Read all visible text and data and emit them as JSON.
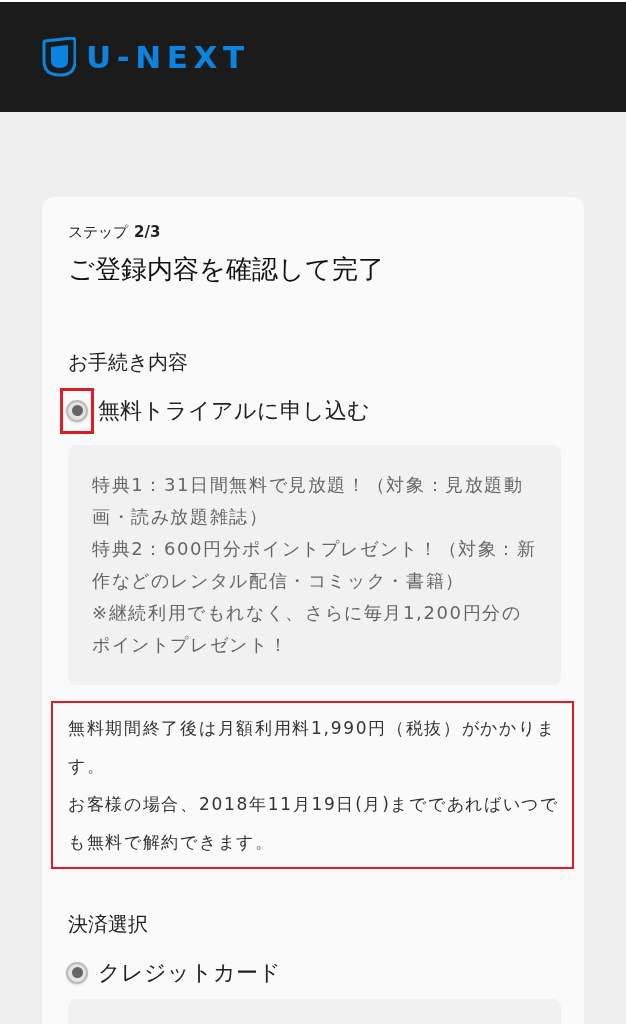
{
  "header": {
    "logo_text": "U-NEXT"
  },
  "card": {
    "step_label": "ステップ",
    "step_value": "2/3",
    "title": "ご登録内容を確認して完了",
    "sections": [
      {
        "heading": "お手続き内容",
        "options": [
          {
            "label": "無料トライアルに申し込む",
            "selected": true,
            "highlighted": true
          }
        ],
        "details": [
          "特典1：31日間無料で見放題！（対象：見放題動画・読み放題雑誌）",
          "特典2：600円分ポイントプレゼント！（対象：新作などのレンタル配信・コミック・書籍）",
          "※継続利用でもれなく、さらに毎月1,200円分のポイントプレゼント！"
        ],
        "notice": {
          "highlighted": true,
          "paragraphs": [
            "無料期間終了後は月額利用料1,990円（税抜）がかかります。",
            "お客様の場合、2018年11月19日(月)までであればいつでも無料で解約できます。"
          ]
        }
      },
      {
        "heading": "決済選択",
        "options": [
          {
            "label": "クレジットカード",
            "selected": true,
            "highlighted": false
          }
        ],
        "details_cut": true
      }
    ]
  }
}
